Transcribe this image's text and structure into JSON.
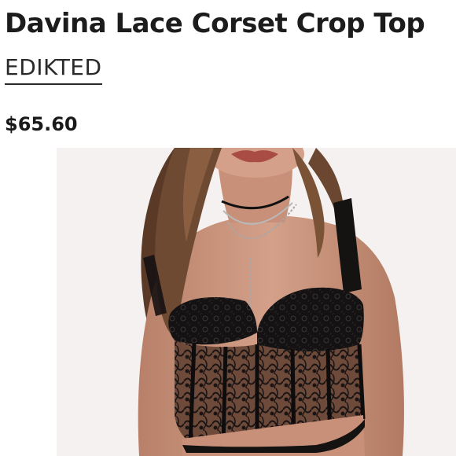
{
  "product": {
    "title": "Davina Lace Corset Crop Top",
    "brand": "EDIKTED",
    "price": "$65.60"
  },
  "image": {
    "subject": "model-wearing-black-lace-corset",
    "background_color": "#f4f1f0"
  }
}
